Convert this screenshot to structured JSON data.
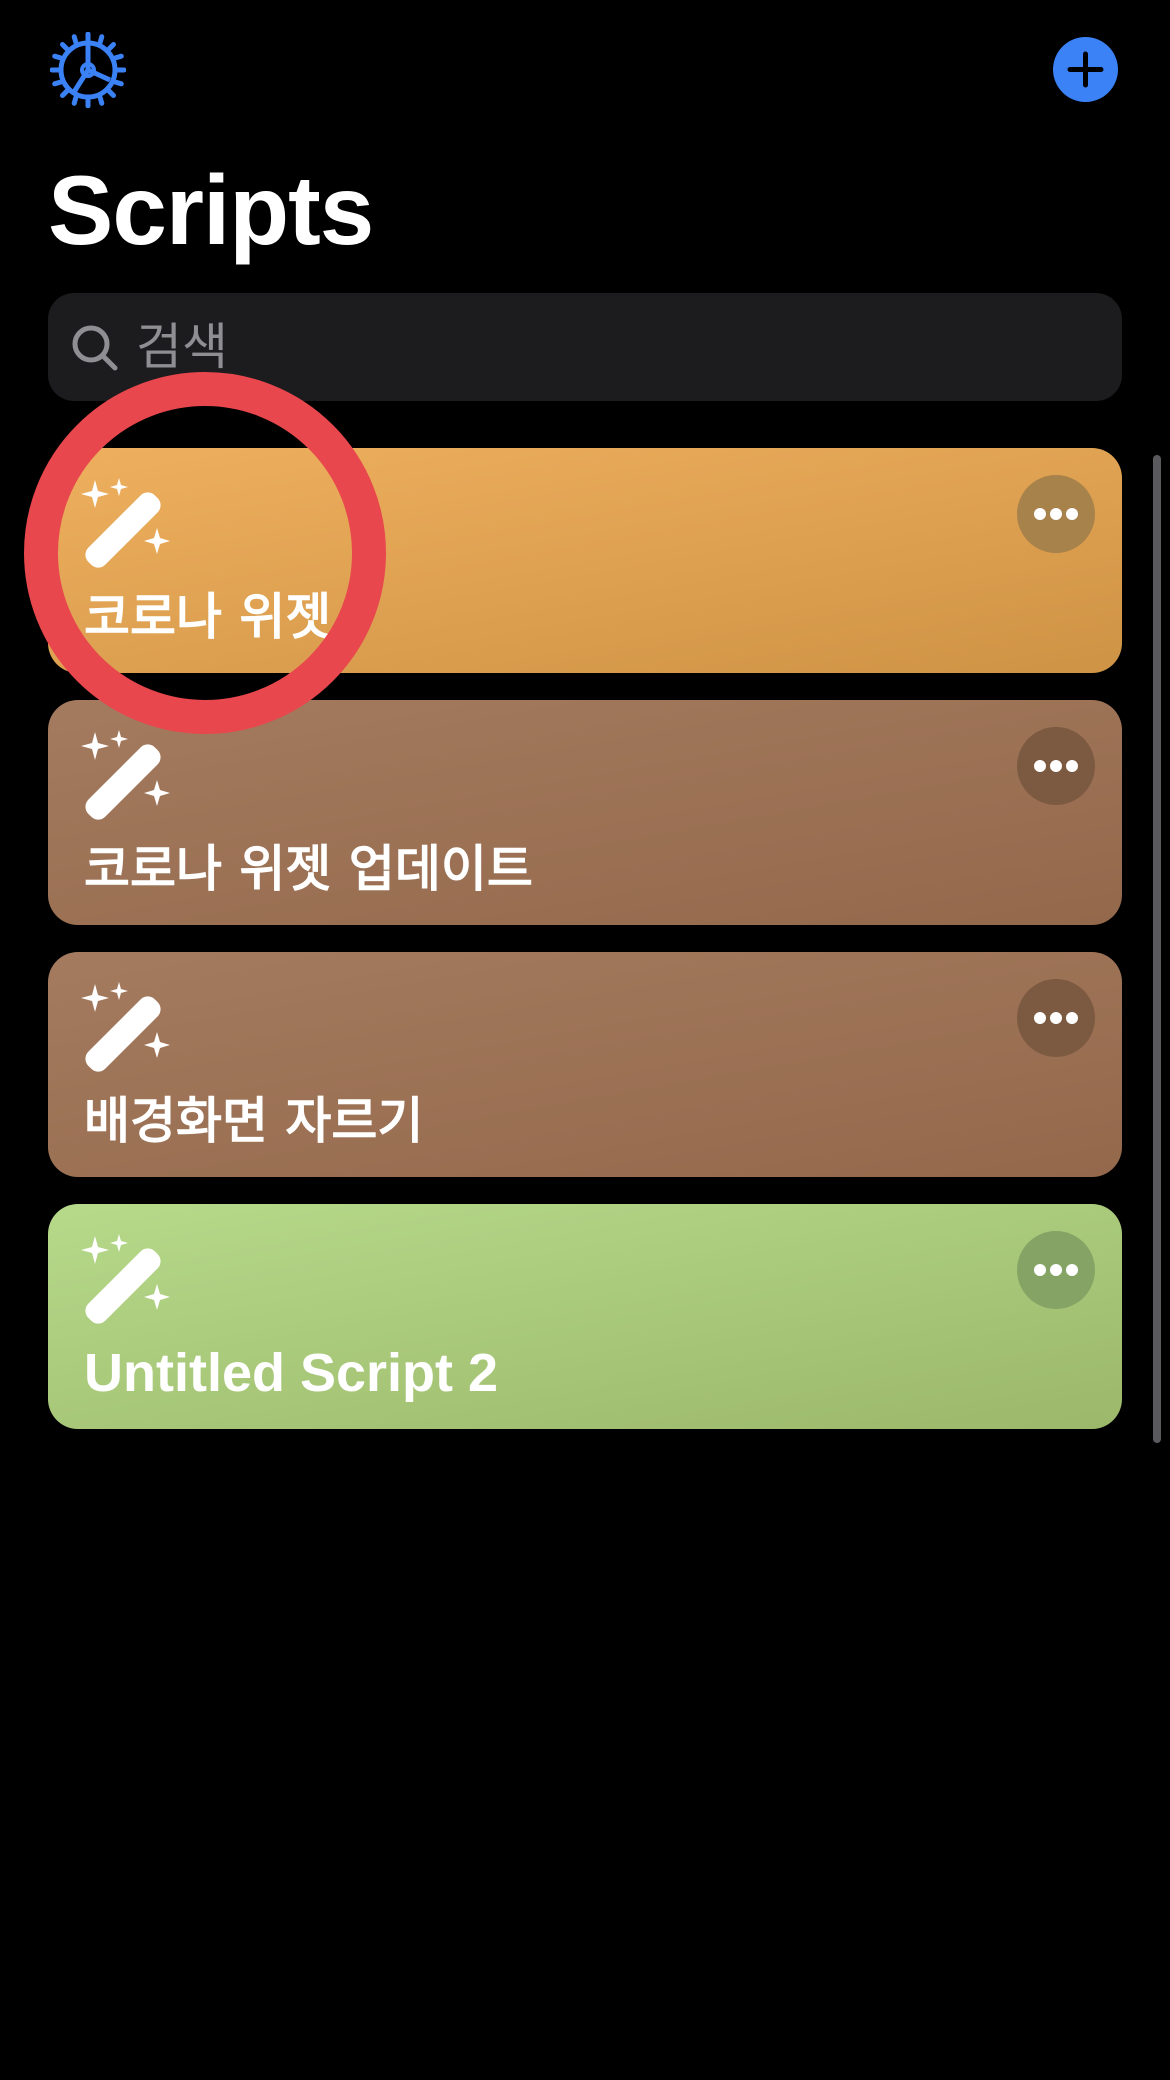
{
  "header": {
    "title": "Scripts",
    "settings_icon": "gear-icon",
    "add_icon": "plus-icon",
    "accent_color": "#3b82f6"
  },
  "search": {
    "placeholder": "검색",
    "value": "",
    "icon": "search-icon"
  },
  "scripts": [
    {
      "name": "코로나 위젯",
      "icon": "magic-wand-icon",
      "color_top": "#eeb05e",
      "color_bottom": "#cf9345",
      "more_color": "#a8824b"
    },
    {
      "name": "코로나 위젯 업데이트",
      "icon": "magic-wand-icon",
      "color_top": "#a47b5f",
      "color_bottom": "#94684b",
      "more_color": "#7c5a41"
    },
    {
      "name": "배경화면 자르기",
      "icon": "magic-wand-icon",
      "color_top": "#a47b5f",
      "color_bottom": "#94684b",
      "more_color": "#7c5a41"
    },
    {
      "name": "Untitled Script 2",
      "icon": "magic-wand-icon",
      "color_top": "#b6d98a",
      "color_bottom": "#9cb86a",
      "more_color": "#86a366"
    }
  ],
  "annotation": {
    "highlight_color": "#e8474d"
  }
}
